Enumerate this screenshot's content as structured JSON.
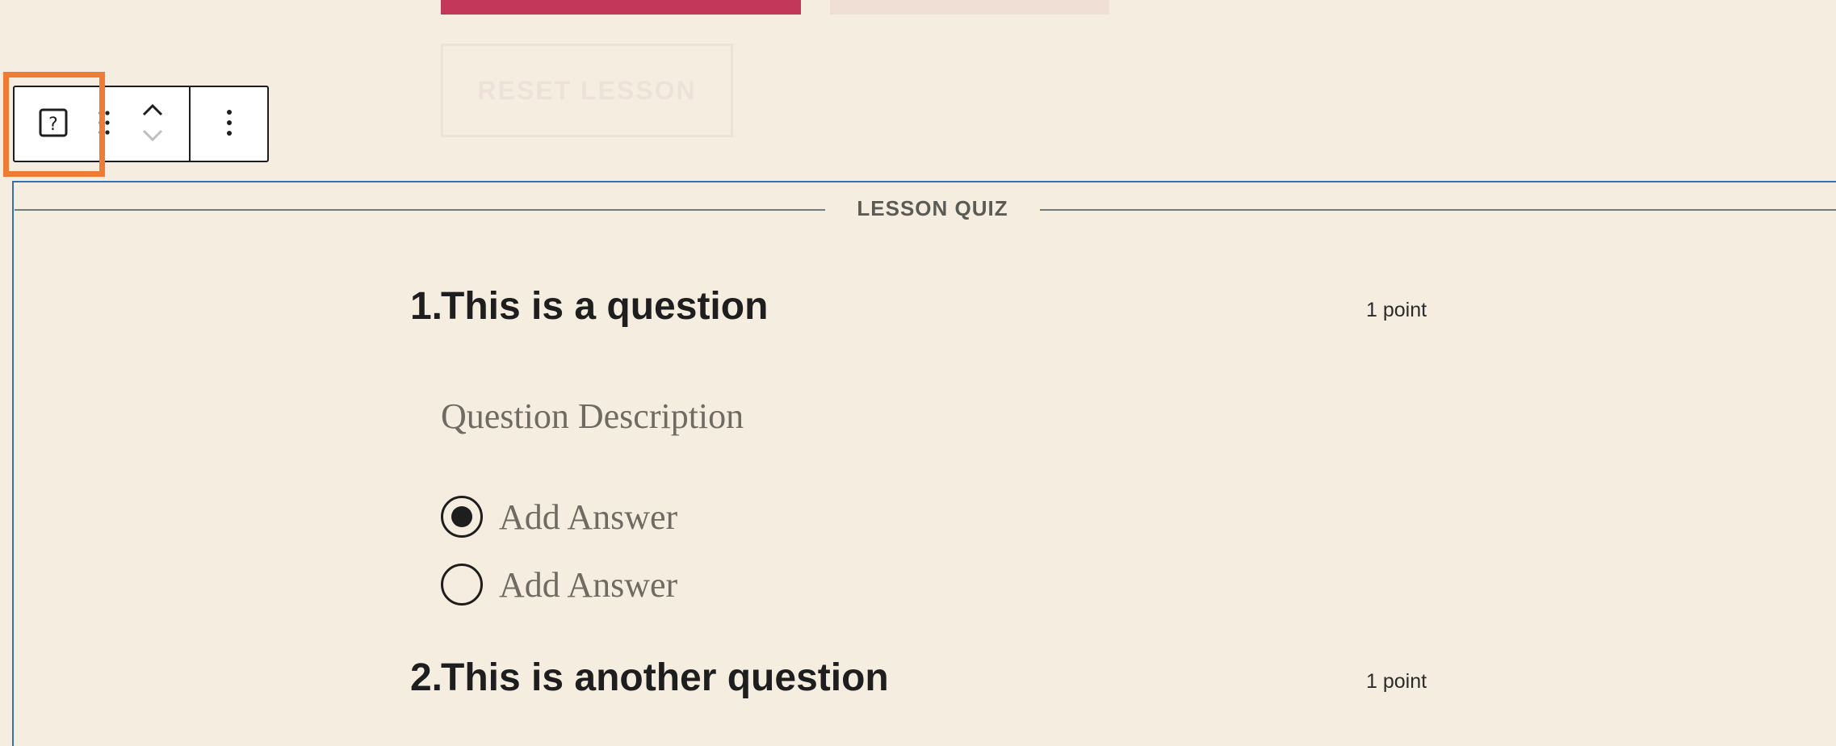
{
  "top_buttons": {
    "primary_color": "#c3375a",
    "secondary_color": "#f0dfd4",
    "reset_label": "RESET LESSON"
  },
  "toolbar": {
    "block_type_icon": "question-block-icon",
    "drag_icon": "drag-handle-icon",
    "move_up_icon": "chevron-up-icon",
    "move_down_icon": "chevron-down-icon",
    "more_icon": "more-vertical-icon",
    "highlight_color": "#f07b35"
  },
  "quiz": {
    "title": "LESSON QUIZ",
    "border_color": "#3471b3",
    "questions": [
      {
        "number": "1.",
        "title": "This is a question",
        "points": "1 point",
        "description": "Question Description",
        "answers": [
          {
            "label": "Add Answer",
            "selected": true
          },
          {
            "label": "Add Answer",
            "selected": false
          }
        ]
      },
      {
        "number": "2.",
        "title": "This is another question",
        "points": "1 point"
      }
    ]
  }
}
